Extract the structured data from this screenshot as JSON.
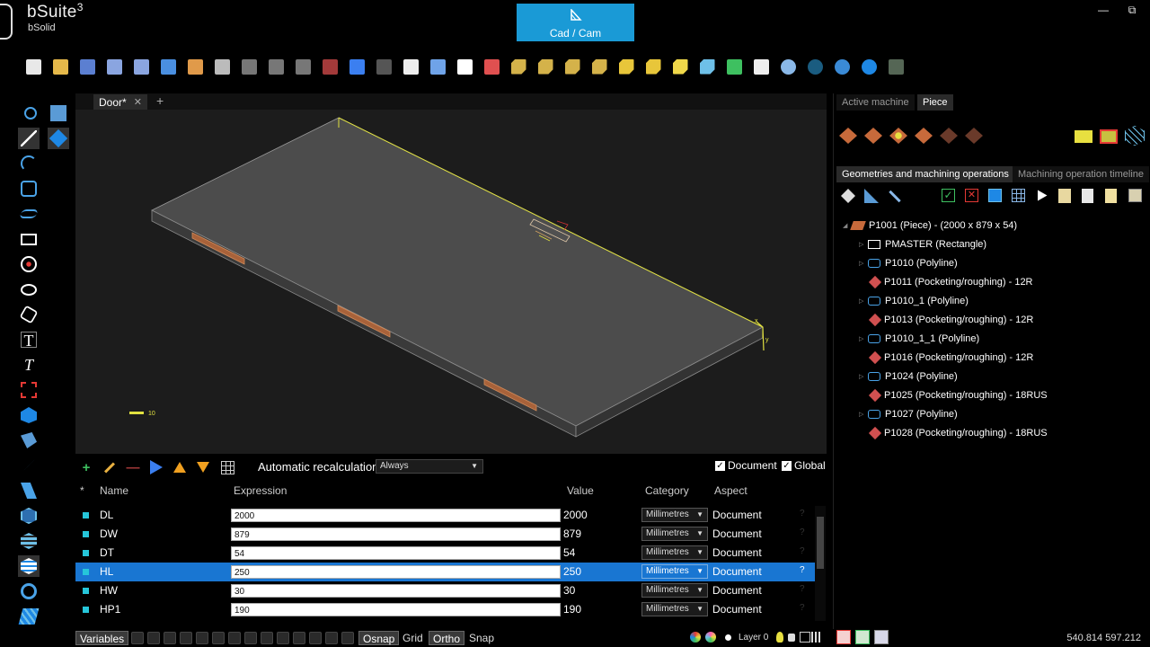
{
  "app": {
    "name": "bSuite",
    "superscript": "3",
    "subtitle": "bSolid",
    "mode_button": "Cad / Cam",
    "minimize_glyph": "—",
    "maximize_glyph": "⧉"
  },
  "document": {
    "tab_title": "Door*",
    "close_glyph": "✕",
    "add_glyph": "+"
  },
  "viewport": {
    "scale_bar_label": "10",
    "axis_x": "x",
    "axis_y": "y"
  },
  "variables": {
    "recalc_label": "Automatic recalculation",
    "recalc_value": "Always",
    "check_document": "Document",
    "check_global": "Global",
    "columns": {
      "star": "*",
      "name": "Name",
      "expression": "Expression",
      "value": "Value",
      "category": "Category",
      "aspect": "Aspect"
    },
    "rows": [
      {
        "name": "DL",
        "expression": "2000",
        "value": "2000",
        "category": "Millimetres",
        "aspect": "Document",
        "q": "?"
      },
      {
        "name": "DW",
        "expression": "879",
        "value": "879",
        "category": "Millimetres",
        "aspect": "Document",
        "q": "?"
      },
      {
        "name": "DT",
        "expression": "54",
        "value": "54",
        "category": "Millimetres",
        "aspect": "Document",
        "q": "?"
      },
      {
        "name": "HL",
        "expression": "250",
        "value": "250",
        "category": "Millimetres",
        "aspect": "Document",
        "q": "?"
      },
      {
        "name": "HW",
        "expression": "30",
        "value": "30",
        "category": "Millimetres",
        "aspect": "Document",
        "q": "?"
      },
      {
        "name": "HP1",
        "expression": "190",
        "value": "190",
        "category": "Millimetres",
        "aspect": "Document",
        "q": "?"
      }
    ],
    "selected_row": "HL"
  },
  "statusbar": {
    "variables": "Variables",
    "osnap": "Osnap",
    "grid": "Grid",
    "ortho": "Ortho",
    "snap": "Snap",
    "layer": "Layer 0",
    "coords": "540.814  597.212"
  },
  "right_panel": {
    "tabs_top": [
      "Active machine",
      "Piece"
    ],
    "tabs_ops": [
      "Geometries and machining operations",
      "Machining operation timeline"
    ],
    "tree": [
      {
        "label": "P1001 (Piece) - (2000 x 879 x 54)",
        "type": "piece",
        "level": 0,
        "expander": "◢"
      },
      {
        "label": "PMASTER (Rectangle)",
        "type": "rect",
        "level": 1,
        "expander": "▷"
      },
      {
        "label": "P1010 (Polyline)",
        "type": "poly",
        "level": 1,
        "expander": "▷"
      },
      {
        "label": "P1011 (Pocketing/roughing) - 12R",
        "type": "pocket",
        "level": 1,
        "expander": ""
      },
      {
        "label": "P1010_1 (Polyline)",
        "type": "poly",
        "level": 1,
        "expander": "▷"
      },
      {
        "label": "P1013 (Pocketing/roughing) - 12R",
        "type": "pocket",
        "level": 1,
        "expander": ""
      },
      {
        "label": "P1010_1_1 (Polyline)",
        "type": "poly",
        "level": 1,
        "expander": "▷"
      },
      {
        "label": "P1016 (Pocketing/roughing) - 12R",
        "type": "pocket",
        "level": 1,
        "expander": ""
      },
      {
        "label": "P1024 (Polyline)",
        "type": "poly",
        "level": 1,
        "expander": "▷"
      },
      {
        "label": "P1025 (Pocketing/roughing) - 18RUS",
        "type": "pocket",
        "level": 1,
        "expander": ""
      },
      {
        "label": "P1027 (Polyline)",
        "type": "poly",
        "level": 1,
        "expander": "▷"
      },
      {
        "label": "P1028 (Pocketing/roughing) - 18RUS",
        "type": "pocket",
        "level": 1,
        "expander": ""
      }
    ]
  },
  "icons": {
    "toolbar": [
      "new-file-icon",
      "open-folder-icon",
      "save-icon",
      "save-as-icon",
      "settings-save-icon",
      "import-icon",
      "export-icon",
      "print-icon",
      "cut-icon",
      "copy-icon",
      "paste-icon",
      "delete-icon",
      "undo-icon",
      "redo-icon",
      "move-icon",
      "rotate-icon",
      "pan-icon",
      "zoom-extents-icon",
      "view-front-icon",
      "view-back-icon",
      "view-left-icon",
      "view-right-icon",
      "view-top-icon",
      "view-bottom-icon",
      "view-iso-icon",
      "view-3d-icon",
      "select-icon",
      "refresh-icon",
      "globe-grid-icon",
      "sphere-icon",
      "earth-icon",
      "help-icon",
      "screen-icon"
    ],
    "toolbar_colors": [
      "#e8e8e8",
      "#e6b94a",
      "#5b7fd1",
      "#8aa5e0",
      "#8aa5e0",
      "#4a8fe0",
      "#e09a4a",
      "#bbbbbb",
      "#777777",
      "#777777",
      "#777777",
      "#a33a3a",
      "#3b7ff0",
      "#555555",
      "#eeeeee",
      "#6fa3e8",
      "#ffffff",
      "#e05050",
      "#d4b24a",
      "#d4b24a",
      "#d4b24a",
      "#d4b24a",
      "#e8c63a",
      "#e8c63a",
      "#f0d84a",
      "#6ec0e8",
      "#3ec060",
      "#eeeeee",
      "#8ab8e8",
      "#1a5c80",
      "#3a8ad6",
      "#1e88e5",
      "#556655"
    ]
  }
}
